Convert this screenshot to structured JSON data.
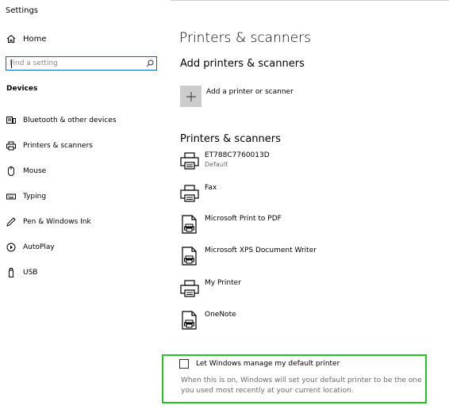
{
  "window": {
    "title": "Settings"
  },
  "sidebar": {
    "home_label": "Home",
    "search_placeholder": "Find a setting",
    "section_title": "Devices",
    "items": [
      {
        "label": "Bluetooth & other devices",
        "icon": "bluetooth-devices-icon"
      },
      {
        "label": "Printers & scanners",
        "icon": "printer-icon"
      },
      {
        "label": "Mouse",
        "icon": "mouse-icon"
      },
      {
        "label": "Typing",
        "icon": "keyboard-icon"
      },
      {
        "label": "Pen & Windows Ink",
        "icon": "pen-icon"
      },
      {
        "label": "AutoPlay",
        "icon": "autoplay-icon"
      },
      {
        "label": "USB",
        "icon": "usb-icon"
      }
    ]
  },
  "main": {
    "page_title": "Printers & scanners",
    "add_section": {
      "heading": "Add printers & scanners",
      "add_label": "Add a printer or scanner"
    },
    "list_section": {
      "heading": "Printers & scanners",
      "printers": [
        {
          "name": "ET788C7760013D",
          "status": "Default",
          "icon": "printer-icon"
        },
        {
          "name": "Fax",
          "status": "",
          "icon": "printer-icon"
        },
        {
          "name": "Microsoft Print to PDF",
          "status": "",
          "icon": "document-printer-icon"
        },
        {
          "name": "Microsoft XPS Document Writer",
          "status": "",
          "icon": "document-printer-icon"
        },
        {
          "name": "My Printer",
          "status": "",
          "icon": "printer-icon"
        },
        {
          "name": "OneNote",
          "status": "",
          "icon": "document-printer-icon"
        }
      ]
    },
    "default_printer": {
      "checkbox_label": "Let Windows manage my default printer",
      "checked": false,
      "description": "When this is on, Windows will set your default printer to be the one you used most recently at your current location."
    }
  },
  "colors": {
    "highlight_border": "#22c71e",
    "search_border": "#0a64c8",
    "add_button_bg": "#cccccc"
  }
}
